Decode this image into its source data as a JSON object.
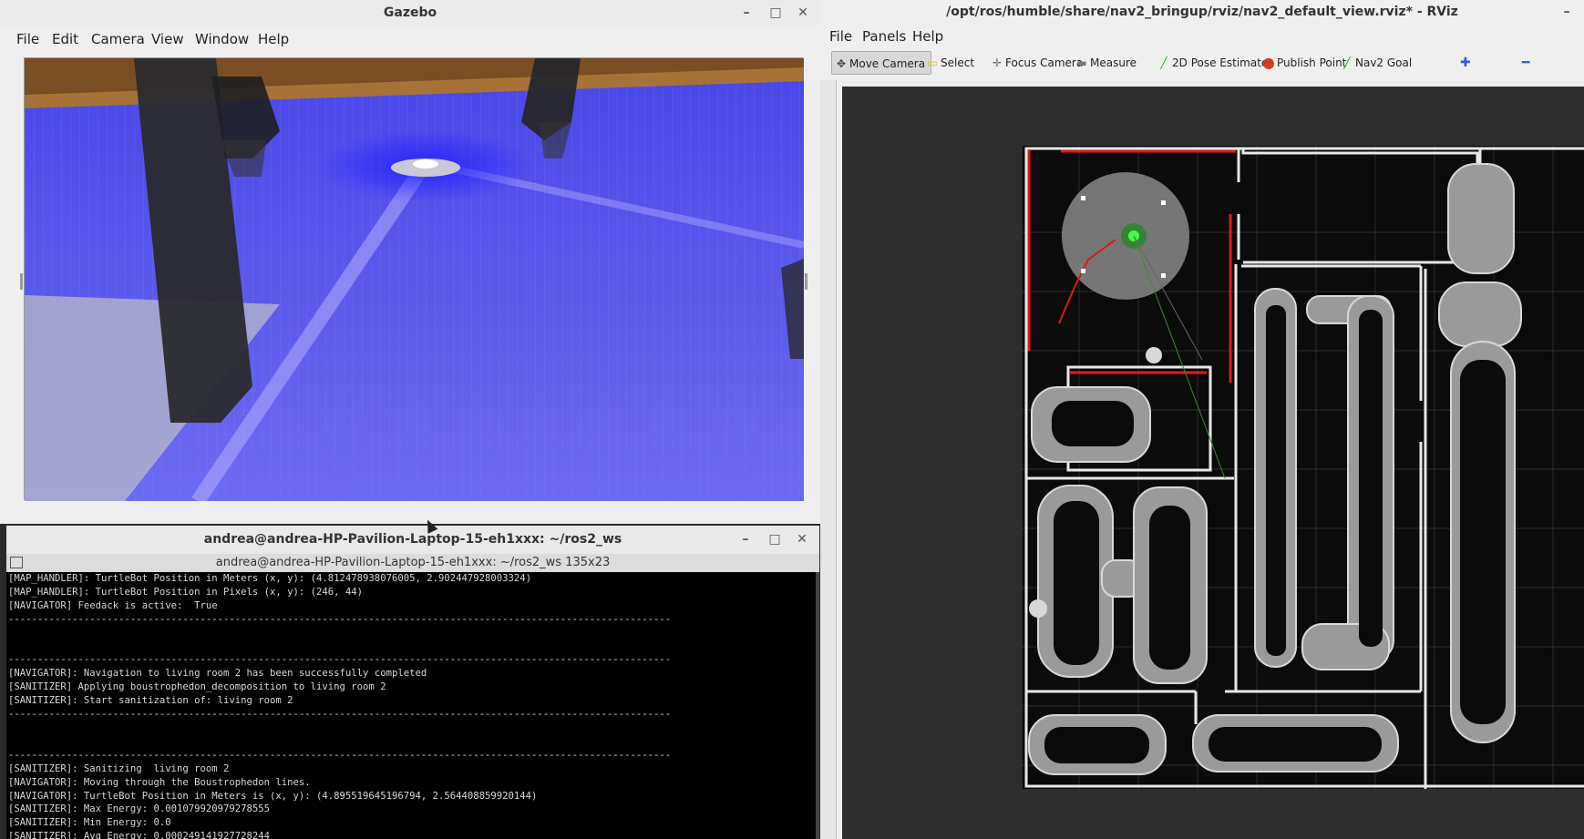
{
  "gazebo": {
    "title": "Gazebo",
    "menu": [
      "File",
      "Edit",
      "Camera",
      "View",
      "Window",
      "Help"
    ],
    "window_buttons": [
      "–",
      "□",
      "✕"
    ]
  },
  "terminal": {
    "title": "andrea@andrea-HP-Pavilion-Laptop-15-eh1xxx: ~/ros2_ws",
    "subtitle": "andrea@andrea-HP-Pavilion-Laptop-15-eh1xxx: ~/ros2_ws 135x23",
    "window_buttons": [
      "–",
      "□",
      "✕"
    ],
    "lines": [
      "[MAP_HANDLER]: TurtleBot Position in Meters (x, y): (4.812478938076005, 2.902447928003324)",
      "[MAP_HANDLER]: TurtleBot Position in Pixels (x, y): (246, 44)",
      "[NAVIGATOR] Feedack is active:  True",
      "------------------------------------------------------------------------------------------------------------------",
      "",
      "",
      "------------------------------------------------------------------------------------------------------------------",
      "[NAVIGATOR]: Navigation to living room 2 has been successfully completed",
      "[SANITIZER] Applying boustrophedon_decomposition to living room 2",
      "[SANITIZER]: Start sanitization of: living room 2",
      "------------------------------------------------------------------------------------------------------------------",
      "",
      "",
      "------------------------------------------------------------------------------------------------------------------",
      "[SANITIZER]: Sanitizing  living room 2",
      "[NAVIGATOR]: Moving through the Boustrophedon lines.",
      "[NAVIGATOR]: TurtleBot Position in Meters is (x, y): (4.895519645196794, 2.564408859920144)",
      "[SANITIZER]: Max Energy: 0.001079920979278555",
      "[SANITIZER]: Min Energy: 0.0",
      "[SANITIZER]: Avg Energy: 0.000249141927728244"
    ]
  },
  "rviz": {
    "title": "/opt/ros/humble/share/nav2_bringup/rviz/nav2_default_view.rviz* - RViz",
    "menu": [
      "File",
      "Panels",
      "Help"
    ],
    "window_buttons": [
      "–"
    ],
    "tools": [
      {
        "label": "Move Camera",
        "icon": "move-camera-icon",
        "glyph": "✥",
        "color": "#444444",
        "active": true
      },
      {
        "label": "Select",
        "icon": "select-icon",
        "glyph": "▭",
        "color": "#d8c400",
        "active": false
      },
      {
        "label": "Focus Camera",
        "icon": "focus-camera-icon",
        "glyph": "✛",
        "color": "#666666",
        "active": false
      },
      {
        "label": "Measure",
        "icon": "measure-icon",
        "glyph": "▬",
        "color": "#777777",
        "active": false
      },
      {
        "label": "2D Pose Estimate",
        "icon": "pose-estimate-icon",
        "glyph": "╱",
        "color": "#22aa22",
        "active": false
      },
      {
        "label": "Publish Point",
        "icon": "publish-point-icon",
        "glyph": "⬤",
        "color": "#d04020",
        "active": false
      },
      {
        "label": "Nav2 Goal",
        "icon": "nav2-goal-icon",
        "glyph": "╱",
        "color": "#22aa22",
        "active": false
      }
    ],
    "extra_tools": [
      {
        "name": "add-tool-icon",
        "glyph": "✚",
        "color": "#3060d0"
      },
      {
        "name": "remove-tool-icon",
        "glyph": "━",
        "color": "#3060d0"
      }
    ]
  }
}
